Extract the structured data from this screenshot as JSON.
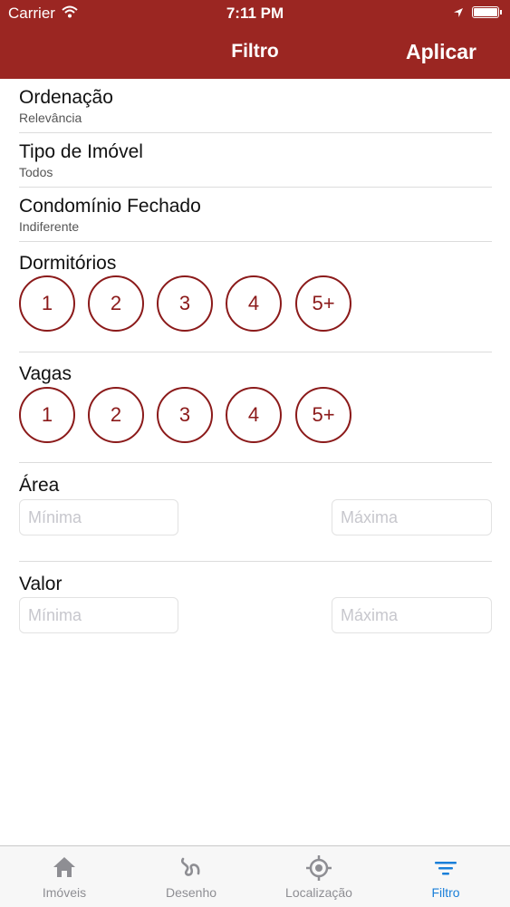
{
  "status": {
    "carrier": "Carrier",
    "time": "7:11 PM"
  },
  "nav": {
    "title": "Filtro",
    "apply_label": "Aplicar"
  },
  "rows": [
    {
      "label": "Ordenação",
      "value": "Relevância"
    },
    {
      "label": "Tipo de Imóvel",
      "value": "Todos"
    },
    {
      "label": "Condomínio Fechado",
      "value": "Indiferente"
    }
  ],
  "dormitorios": {
    "title": "Dormitórios",
    "options": [
      "1",
      "2",
      "3",
      "4",
      "5+"
    ]
  },
  "vagas": {
    "title": "Vagas",
    "options": [
      "1",
      "2",
      "3",
      "4",
      "5+"
    ]
  },
  "area": {
    "title": "Área",
    "min_placeholder": "Mínima",
    "max_placeholder": "Máxima"
  },
  "valor": {
    "title": "Valor",
    "min_placeholder": "Mínima",
    "max_placeholder": "Máxima"
  },
  "tabs": [
    {
      "label": "Imóveis",
      "icon": "house-icon"
    },
    {
      "label": "Desenho",
      "icon": "squiggle-icon"
    },
    {
      "label": "Localização",
      "icon": "location-target-icon"
    },
    {
      "label": "Filtro",
      "icon": "filter-icon",
      "active": true
    }
  ],
  "colors": {
    "header": "#9b2622",
    "accent_circle": "#8b1a1a",
    "tab_active": "#1a7fd9",
    "tab_inactive": "#8e8e93"
  }
}
